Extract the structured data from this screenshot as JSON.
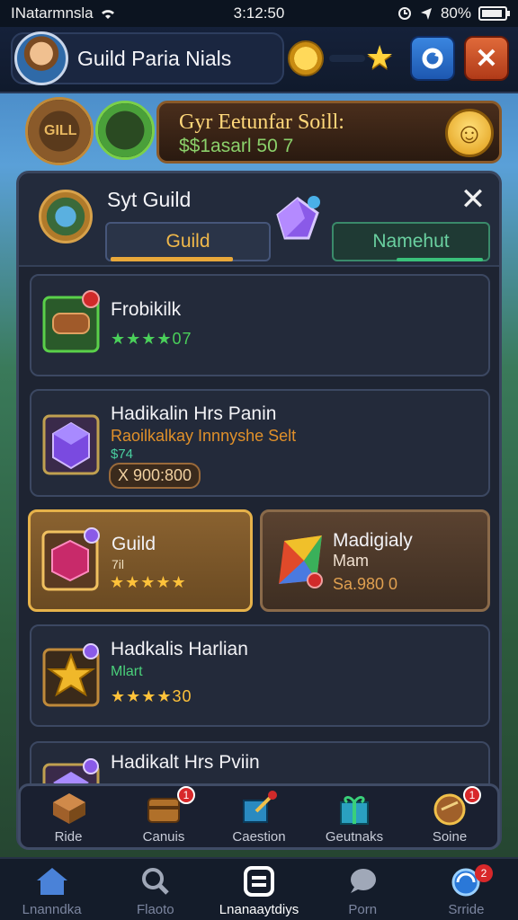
{
  "status_bar": {
    "carrier": "INatarmnsla",
    "time": "3:12:50",
    "battery": "80%"
  },
  "header": {
    "player_name": "Guild Paria Nials"
  },
  "banner": {
    "emblem_label": "GILL",
    "title": "Gyr Eetunfar Soill:",
    "subtitle": "$$1asarl 50 7"
  },
  "panel": {
    "title": "Syt Guild",
    "tabs": [
      {
        "label": "Guild",
        "active": true
      },
      {
        "label": "Namehut",
        "active": false
      }
    ]
  },
  "cards": [
    {
      "title": "Frobikilk",
      "rating": "★★★★07"
    },
    {
      "title": "Hadikalin Hrs Panin",
      "subtitle": "Raoilkalkay Innnyshe Selt",
      "price_label": "$74",
      "price": "X 900:800"
    },
    {
      "title": "Guild",
      "subtitle": "7il",
      "rating": "★★★★★"
    },
    {
      "title": "Madigialy",
      "subtitle": "Mam",
      "price": "Sa.980 0"
    },
    {
      "title": "Hadkalis Harlian",
      "subtitle": "Mlart",
      "rating": "★★★★30"
    },
    {
      "title": "Hadikalt Hrs Pviin"
    }
  ],
  "toolbar": {
    "items": [
      {
        "label": "Ride",
        "icon": "crate-icon"
      },
      {
        "label": "Canuis",
        "icon": "chest-icon",
        "badge": "1"
      },
      {
        "label": "Caestion",
        "icon": "key-icon",
        "badge": ""
      },
      {
        "label": "Geutnaks",
        "icon": "gift-icon"
      },
      {
        "label": "Soine",
        "icon": "shield-icon",
        "badge": "1"
      }
    ]
  },
  "bottom_nav": {
    "items": [
      {
        "label": "Lnanndka",
        "icon": "home-icon"
      },
      {
        "label": "Flaoto",
        "icon": "search-icon"
      },
      {
        "label": "Lnanaaytdiys",
        "icon": "menu-icon",
        "active": true
      },
      {
        "label": "Porn",
        "icon": "chat-icon"
      },
      {
        "label": "Srride",
        "icon": "globe-icon",
        "badge": "2"
      }
    ]
  },
  "colors": {
    "accent_gold": "#e6b24a",
    "accent_green": "#3ac07a",
    "panel_bg": "#1e2432"
  }
}
